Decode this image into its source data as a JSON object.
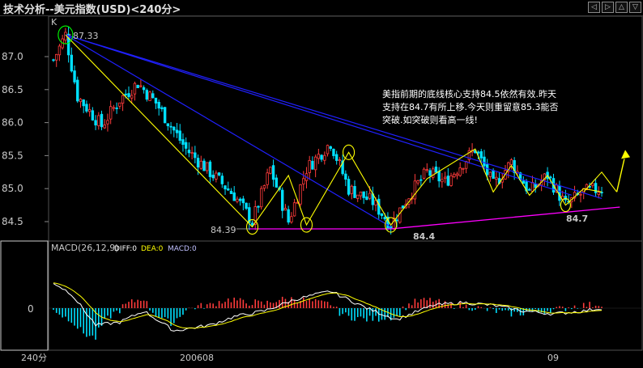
{
  "window": {
    "title": "技术分析--美元指数(USD)<240分>",
    "buttons": [
      {
        "name": "prev-icon",
        "glyph": "◁"
      },
      {
        "name": "next-icon",
        "glyph": "▷"
      },
      {
        "name": "up-icon",
        "glyph": "△"
      },
      {
        "name": "down-icon",
        "glyph": "▽"
      }
    ]
  },
  "colors": {
    "up": "#ff3b3b",
    "down": "#00e0ff",
    "trend_blue": "#2020ff",
    "trend_yellow": "#ffff00",
    "support_magenta": "#ff00ff",
    "macd_diff": "#ffffff",
    "macd_dea": "#ffff00"
  },
  "chart_data": {
    "type": "candlestick",
    "price_axis": {
      "ticks": [
        "87.0",
        "86.5",
        "86.0",
        "85.5",
        "85.0",
        "84.5"
      ],
      "ylim": [
        84.35,
        87.35
      ]
    },
    "corner_label": "K",
    "annotations": {
      "high": "87.33",
      "low1": "84.39",
      "low2": "84.4",
      "low3": "84.7",
      "comment_lines": [
        "美指前期的底线核心支持84.5依然有效.昨天",
        "支持在84.7有所上移.今天则重留意85.3能否",
        "突破.如突破则看高一线!"
      ]
    },
    "anchor_prices": [
      [
        0,
        86.95
      ],
      [
        4,
        87.33
      ],
      [
        8,
        86.4
      ],
      [
        16,
        85.95
      ],
      [
        22,
        86.35
      ],
      [
        28,
        86.6
      ],
      [
        34,
        86.3
      ],
      [
        44,
        85.6
      ],
      [
        52,
        85.25
      ],
      [
        60,
        84.9
      ],
      [
        66,
        84.5
      ],
      [
        72,
        85.3
      ],
      [
        78,
        84.5
      ],
      [
        84,
        85.3
      ],
      [
        92,
        85.7
      ],
      [
        98,
        85.0
      ],
      [
        106,
        84.8
      ],
      [
        112,
        84.45
      ],
      [
        118,
        84.9
      ],
      [
        124,
        85.25
      ],
      [
        130,
        85.1
      ],
      [
        140,
        85.6
      ],
      [
        146,
        85.05
      ],
      [
        152,
        85.4
      ],
      [
        158,
        84.95
      ],
      [
        164,
        85.2
      ],
      [
        170,
        84.75
      ],
      [
        176,
        84.95
      ],
      [
        182,
        85.0
      ]
    ],
    "macd": {
      "indicator_label": "MACD(26,12,9)",
      "diff_label": "DIFF:0",
      "dea_label": "DEA:0",
      "macd_label": "MACD:0",
      "zero_label": "0",
      "anchor_values": [
        [
          0,
          0.45
        ],
        [
          6,
          0.25
        ],
        [
          14,
          -0.3
        ],
        [
          22,
          -0.25
        ],
        [
          30,
          -0.05
        ],
        [
          40,
          -0.4
        ],
        [
          52,
          -0.3
        ],
        [
          60,
          -0.15
        ],
        [
          70,
          -0.05
        ],
        [
          80,
          0.15
        ],
        [
          92,
          0.3
        ],
        [
          104,
          0.0
        ],
        [
          114,
          -0.2
        ],
        [
          126,
          0.05
        ],
        [
          136,
          0.1
        ],
        [
          146,
          0.05
        ],
        [
          156,
          -0.05
        ],
        [
          166,
          -0.1
        ],
        [
          176,
          -0.05
        ],
        [
          182,
          0.0
        ]
      ]
    },
    "x_axis": {
      "period_label": "240分",
      "date_labels": [
        "200608",
        "09"
      ]
    }
  }
}
